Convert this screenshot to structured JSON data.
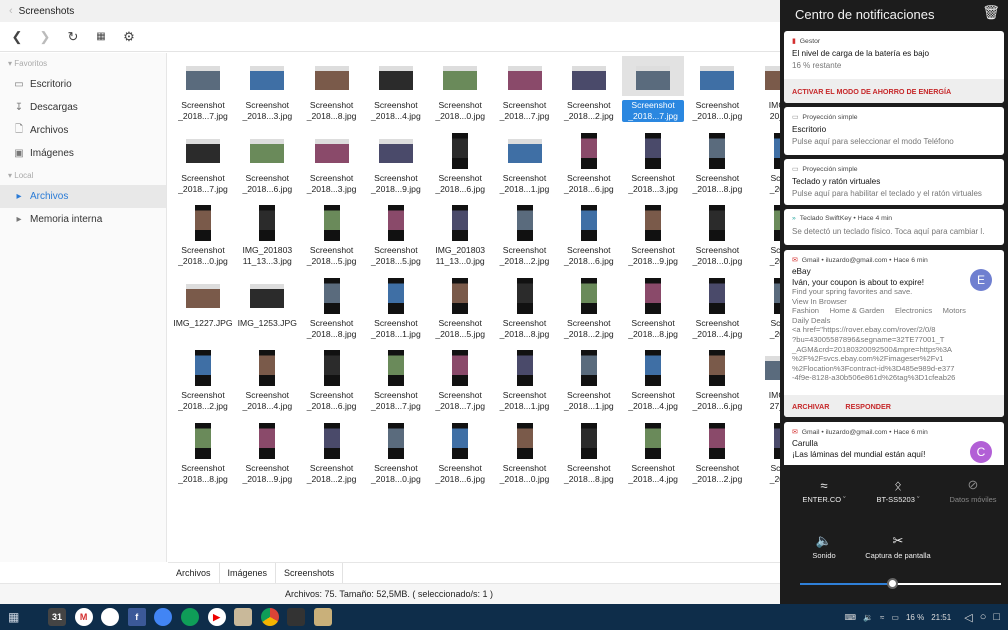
{
  "window": {
    "title": "Screenshots"
  },
  "toolbar": {
    "back": "back",
    "forward": "forward",
    "refresh": "refresh",
    "view": "grid-view",
    "settings": "settings"
  },
  "sidebar": {
    "favorites_label": "Favoritos",
    "favorites": [
      {
        "label": "Escritorio",
        "icon": "desktop-icon"
      },
      {
        "label": "Descargas",
        "icon": "download-icon"
      },
      {
        "label": "Archivos",
        "icon": "file-icon"
      },
      {
        "label": "Imágenes",
        "icon": "image-icon"
      }
    ],
    "local_label": "Local",
    "local": [
      {
        "label": "Archivos",
        "active": true
      },
      {
        "label": "Memoria interna",
        "active": false
      }
    ]
  },
  "files": [
    [
      [
        "Screenshot",
        "_2018...7.jpg",
        "L"
      ],
      [
        "Screenshot",
        "_2018...3.jpg",
        "L"
      ],
      [
        "Screenshot",
        "_2018...8.jpg",
        "L"
      ],
      [
        "Screenshot",
        "_2018...4.jpg",
        "L"
      ],
      [
        "Screenshot",
        "_2018...0.jpg",
        "L"
      ],
      [
        "Screenshot",
        "_2018...7.jpg",
        "L"
      ],
      [
        "Screenshot",
        "_2018...2.jpg",
        "L"
      ],
      [
        "Screenshot",
        "_2018...7.jpg",
        "L",
        "selected"
      ],
      [
        "Screenshot",
        "_2018...0.jpg",
        "L"
      ],
      [
        "IMG_2",
        "20_21",
        "L"
      ]
    ],
    [
      [
        "Screenshot",
        "_2018...7.jpg",
        "L"
      ],
      [
        "Screenshot",
        "_2018...6.jpg",
        "L"
      ],
      [
        "Screenshot",
        "_2018...3.jpg",
        "L"
      ],
      [
        "Screenshot",
        "_2018...9.jpg",
        "L"
      ],
      [
        "Screenshot",
        "_2018...6.jpg",
        "P"
      ],
      [
        "Screenshot",
        "_2018...1.jpg",
        "L"
      ],
      [
        "Screenshot",
        "_2018...6.jpg",
        "P"
      ],
      [
        "Screenshot",
        "_2018...3.jpg",
        "P"
      ],
      [
        "Screenshot",
        "_2018...8.jpg",
        "P"
      ],
      [
        "Scree",
        "_2018",
        "P"
      ]
    ],
    [
      [
        "Screenshot",
        "_2018...0.jpg",
        "P"
      ],
      [
        "IMG_201803",
        "11_13...3.jpg",
        "P"
      ],
      [
        "Screenshot",
        "_2018...5.jpg",
        "P"
      ],
      [
        "Screenshot",
        "_2018...5.jpg",
        "P"
      ],
      [
        "IMG_201803",
        "11_13...0.jpg",
        "P"
      ],
      [
        "Screenshot",
        "_2018...2.jpg",
        "P"
      ],
      [
        "Screenshot",
        "_2018...6.jpg",
        "P"
      ],
      [
        "Screenshot",
        "_2018...9.jpg",
        "P"
      ],
      [
        "Screenshot",
        "_2018...0.jpg",
        "P"
      ],
      [
        "Scree",
        "_2018",
        "P"
      ]
    ],
    [
      [
        "IMG_1227.JPG",
        "",
        "L"
      ],
      [
        "IMG_1253.JPG",
        "",
        "L"
      ],
      [
        "Screenshot",
        "_2018...8.jpg",
        "P"
      ],
      [
        "Screenshot",
        "_2018...1.jpg",
        "P"
      ],
      [
        "Screenshot",
        "_2018...5.jpg",
        "P"
      ],
      [
        "Screenshot",
        "_2018...8.jpg",
        "P"
      ],
      [
        "Screenshot",
        "_2018...2.jpg",
        "P"
      ],
      [
        "Screenshot",
        "_2018...8.jpg",
        "P"
      ],
      [
        "Screenshot",
        "_2018...4.jpg",
        "P"
      ],
      [
        "Scree",
        "_2018",
        "P"
      ]
    ],
    [
      [
        "Screenshot",
        "_2018...2.jpg",
        "P"
      ],
      [
        "Screenshot",
        "_2018...4.jpg",
        "P"
      ],
      [
        "Screenshot",
        "_2018...6.jpg",
        "P"
      ],
      [
        "Screenshot",
        "_2018...7.jpg",
        "P"
      ],
      [
        "Screenshot",
        "_2018...7.jpg",
        "P"
      ],
      [
        "Screenshot",
        "_2018...1.jpg",
        "P"
      ],
      [
        "Screenshot",
        "_2018...1.jpg",
        "P"
      ],
      [
        "Screenshot",
        "_2018...4.jpg",
        "P"
      ],
      [
        "Screenshot",
        "_2018...6.jpg",
        "P"
      ],
      [
        "IMG_2",
        "27_07",
        "L"
      ]
    ],
    [
      [
        "Screenshot",
        "_2018...8.jpg",
        "P"
      ],
      [
        "Screenshot",
        "_2018...9.jpg",
        "P"
      ],
      [
        "Screenshot",
        "_2018...2.jpg",
        "P"
      ],
      [
        "Screenshot",
        "_2018...0.jpg",
        "P"
      ],
      [
        "Screenshot",
        "_2018...6.jpg",
        "P"
      ],
      [
        "Screenshot",
        "_2018...0.jpg",
        "P"
      ],
      [
        "Screenshot",
        "_2018...8.jpg",
        "P"
      ],
      [
        "Screenshot",
        "_2018...4.jpg",
        "P"
      ],
      [
        "Screenshot",
        "_2018...2.jpg",
        "P"
      ],
      [
        "Scree",
        "_2018",
        "P"
      ]
    ]
  ],
  "breadcrumb": [
    "Archivos",
    "Imágenes",
    "Screenshots"
  ],
  "status": "Archivos: 75. Tamaño: 52,5MB. ( seleccionado/s: 1 )",
  "notifications": {
    "title": "Centro de notificaciones",
    "items": [
      {
        "app": "Gestor",
        "title": "El nivel de carga de la batería es bajo",
        "text": "16 % restante",
        "action": "ACTIVAR EL MODO DE AHORRO DE ENERGÍA"
      },
      {
        "app": "Proyección simple",
        "title": "Escritorio",
        "text": "Pulse aquí para seleccionar el modo Teléfono"
      },
      {
        "app": "Proyección simple",
        "title": "Teclado y ratón virtuales",
        "text": "Pulse aquí para habilitar el teclado y el ratón virtuales"
      },
      {
        "app": "Teclado SwiftKey • Hace 4 min",
        "text": "Se detectó un teclado físico. Toca aquí para cambiar l."
      },
      {
        "app": "Gmail • iluzardo@gmail.com • Hace 6 min",
        "title": "eBay",
        "subtitle": "Iván, your coupon is about to expire!",
        "avatar": "E",
        "avatar_color": "#6f7fd0",
        "lines": [
          "Find your spring favorites and save.",
          "View In Browser",
          "Fashion     Home & Garden     Electronics     Motors",
          "Daily Deals",
          "<a href=\"https://rover.ebay.com/rover/2/0/8",
          "?bu=43005587896&segname=32TE77001_T",
          "_AGM&crd=20180320092500&mpre=https%3A",
          "%2F%2Fsvcs.ebay.com%2Fimageser%2Fv1",
          "%2Flocation%3Fcontract-id%3D485e989d-e377",
          "-4f9e-8128-a30b506e861d%26tag%3D1cfeab26"
        ],
        "actions": [
          "ARCHIVAR",
          "RESPONDER"
        ]
      },
      {
        "app": "Gmail • iluzardo@gmail.com • Hace 6 min",
        "title": "Carulla",
        "subtitle": "¡Las láminas del mundial están aquí!",
        "avatar": "C",
        "avatar_color": "#b25fd6"
      }
    ]
  },
  "quick_settings": {
    "wifi": "ENTER.CO",
    "bluetooth": "BT-SS5203",
    "mobile_data": "Datos móviles",
    "sound": "Sonido",
    "screenshot": "Captura de pantalla",
    "brightness_percent": 46
  },
  "taskbar": {
    "apps": [
      "calendar",
      "gmail",
      "drive",
      "facebook",
      "docs",
      "sheets",
      "youtube",
      "music",
      "chrome",
      "wallet",
      "notes"
    ],
    "calendar_label": "31",
    "battery": "16 %",
    "time": "21:51"
  }
}
